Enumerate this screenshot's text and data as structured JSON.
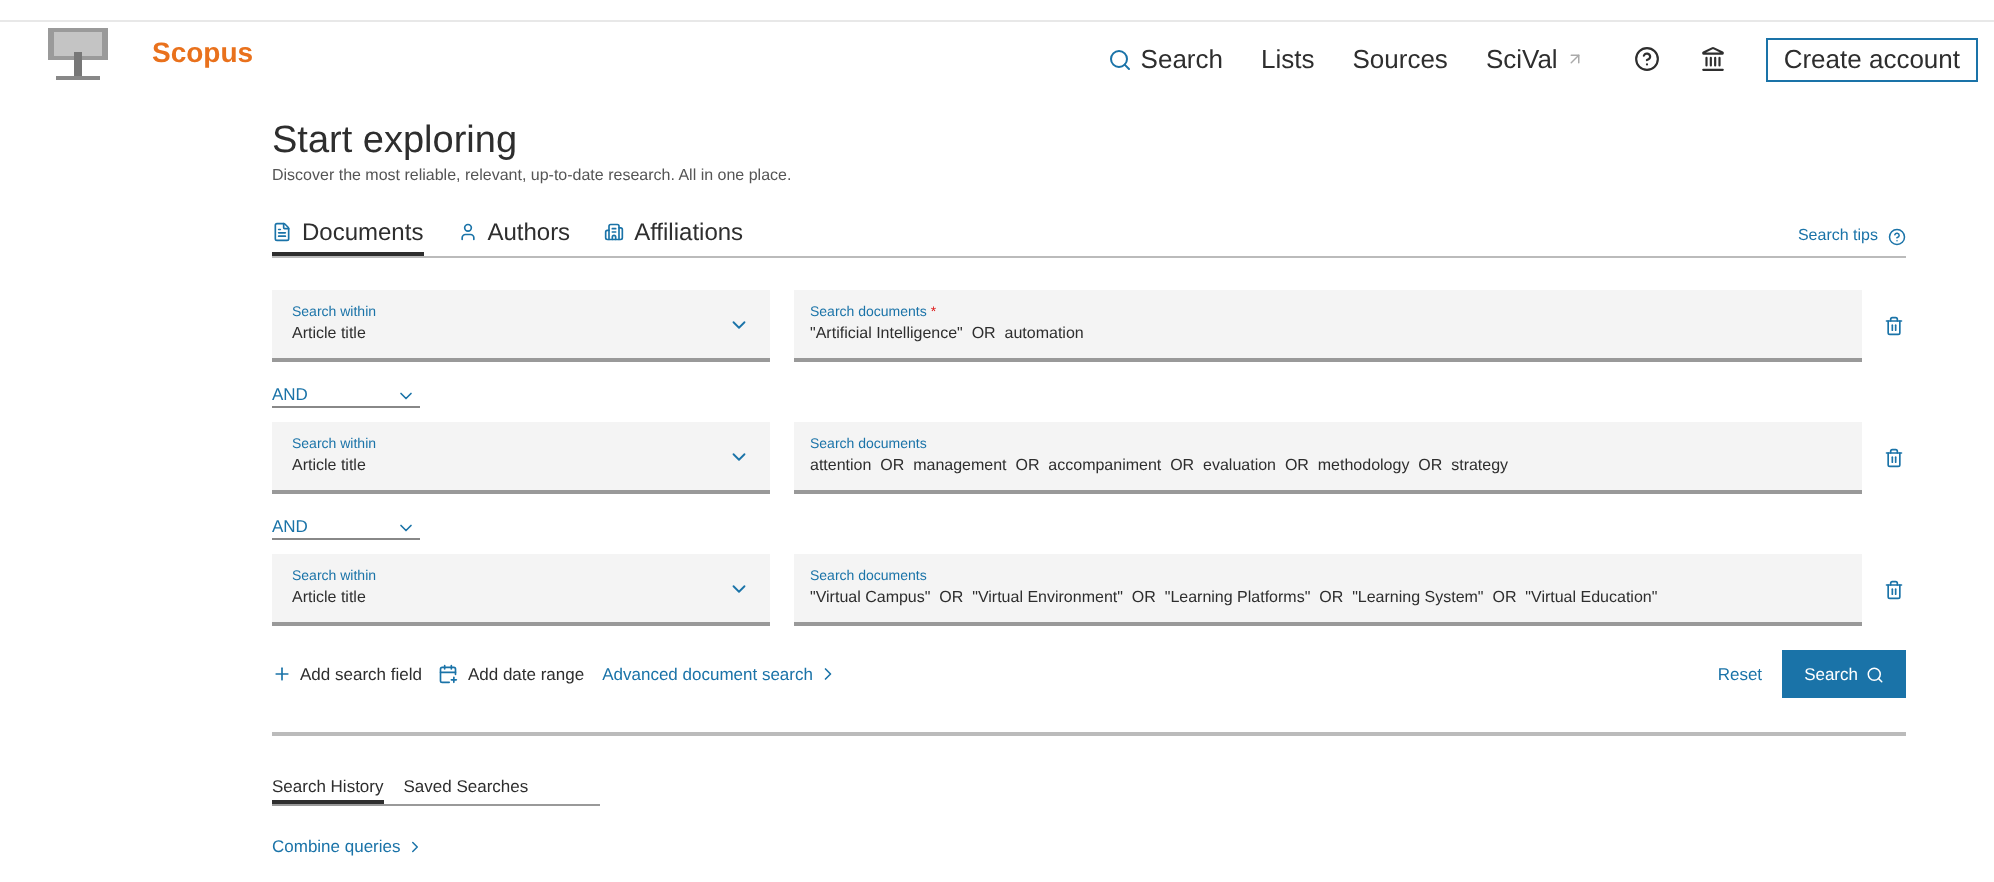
{
  "header": {
    "brand": "Scopus",
    "nav": [
      {
        "label": "Search",
        "kind": "search"
      },
      {
        "label": "Lists",
        "kind": "plain"
      },
      {
        "label": "Sources",
        "kind": "plain"
      },
      {
        "label": "SciVal",
        "kind": "external"
      }
    ],
    "create_account": "Create account"
  },
  "title": "Start exploring",
  "subtitle": "Discover the most reliable, relevant, up-to-date research. All in one place.",
  "tabs": [
    {
      "label": "Documents",
      "selected": true,
      "kind": "documents"
    },
    {
      "label": "Authors",
      "selected": false,
      "kind": "authors"
    },
    {
      "label": "Affiliations",
      "selected": false,
      "kind": "affiliations"
    }
  ],
  "search_tips": "Search tips",
  "rows": [
    {
      "within_label": "Search within",
      "within_value": "Article title",
      "query_label": "Search documents",
      "required_mark": "*",
      "query": "\"Artificial Intelligence\"  OR  automation"
    },
    {
      "operator": "AND",
      "within_label": "Search within",
      "within_value": "Article title",
      "query_label": "Search documents",
      "query": "attention  OR  management  OR  accompaniment  OR  evaluation  OR  methodology  OR  strategy"
    },
    {
      "operator": "AND",
      "within_label": "Search within",
      "within_value": "Article title",
      "query_label": "Search documents",
      "query": "\"Virtual Campus\"  OR  \"Virtual Environment\"  OR  \"Learning Platforms\"  OR  \"Learning System\"  OR  \"Virtual Education\""
    }
  ],
  "actions": {
    "add_field": "Add search field",
    "add_date": "Add date range",
    "advanced": "Advanced document search",
    "reset": "Reset",
    "search": "Search"
  },
  "history_tabs": [
    {
      "label": "Search History",
      "selected": true
    },
    {
      "label": "Saved Searches",
      "selected": false
    }
  ],
  "combine": "Combine queries"
}
